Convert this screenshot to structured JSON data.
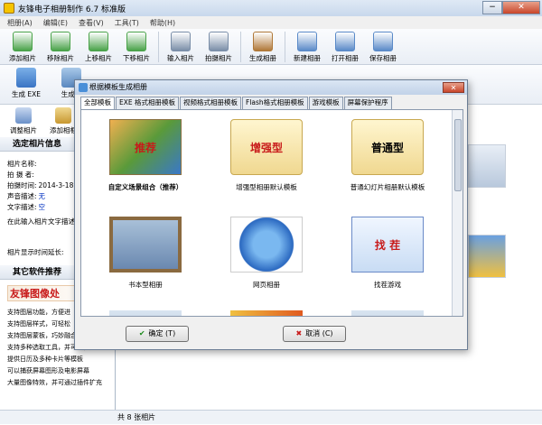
{
  "window": {
    "title": "友锋电子相册制作 6.7 标准版",
    "min": "−",
    "max": "□",
    "close": "✕"
  },
  "menu": [
    "相册(A)",
    "编辑(E)",
    "查看(V)",
    "工具(T)",
    "帮助(H)"
  ],
  "toolbar": [
    {
      "label": "添加相片",
      "icon": "add-photo-icon",
      "color": "#4aa34a"
    },
    {
      "label": "移除相片",
      "icon": "remove-photo-icon",
      "color": "#4aa34a"
    },
    {
      "label": "上移相片",
      "icon": "move-up-icon",
      "color": "#4aa34a"
    },
    {
      "label": "下移相片",
      "icon": "move-down-icon",
      "color": "#4aa34a"
    },
    {
      "label": "输入相片",
      "icon": "import-icon",
      "color": "#7a8ea8"
    },
    {
      "label": "拍摄相片",
      "icon": "camera-icon",
      "color": "#7a8ea8"
    },
    {
      "label": "生成相册",
      "icon": "generate-icon",
      "color": "#b07838"
    },
    {
      "label": "新建相册",
      "icon": "new-album-icon",
      "color": "#5a8ac8"
    },
    {
      "label": "打开相册",
      "icon": "open-album-icon",
      "color": "#5a8ac8"
    },
    {
      "label": "保存相册",
      "icon": "save-album-icon",
      "color": "#5a8ac8"
    }
  ],
  "toolbar2": [
    {
      "label": "生成 EXE",
      "icon": "exe-icon"
    },
    {
      "label": "生成相",
      "icon": "album-icon"
    }
  ],
  "toolbar3": [
    {
      "label": "调整相片",
      "icon": "adjust-icon"
    },
    {
      "label": "添加相框",
      "icon": "frame-icon"
    }
  ],
  "side": {
    "header": "选定相片信息",
    "name_label": "相片名称:",
    "author_label": "拍 摄 者:",
    "time_label": "拍摄时间:",
    "time_value": "2014-3-18",
    "sound_label": "声音描述:",
    "sound_value": "无",
    "text_label": "文字描述:",
    "text_value": "空",
    "hint": "在此输入相片文字描述",
    "delay": "相片显示时间延长:",
    "recommend_header": "其它软件推荐",
    "promo": "友锋图像处",
    "list": [
      "支持图层功能，方便进",
      "支持图层样式，可轻松",
      "支持图层蒙板，巧妙融合图像",
      "支持多种选取工具，并可羽化选区",
      "提供日历及多种卡片等模板",
      "可以捕获屏幕图形及电影屏幕",
      "大量图像特效，并可通过插件扩充"
    ]
  },
  "status": "共 8 张相片",
  "dialog": {
    "title": "根据模板生成相册",
    "close": "✕",
    "tabs": [
      "全部模板",
      "EXE 格式相册模板",
      "视频格式相册模板",
      "Flash格式相册模板",
      "游戏模板",
      "屏幕保护程序"
    ],
    "active_tab": 0,
    "items": [
      {
        "caption": "自定义场景组合（推荐）",
        "bold": true,
        "thumb": "scene",
        "text": "推荐"
      },
      {
        "caption": "增强型相册默认模板",
        "bold": false,
        "thumb": "folder",
        "text": "增强型"
      },
      {
        "caption": "普通幻灯片相册默认模板",
        "bold": false,
        "thumb": "folder",
        "text": "普通型"
      },
      {
        "caption": "书本型相册",
        "bold": false,
        "thumb": "book",
        "text": ""
      },
      {
        "caption": "网页相册",
        "bold": false,
        "thumb": "ie",
        "text": ""
      },
      {
        "caption": "找茬游戏",
        "bold": false,
        "thumb": "game",
        "text": "找 茬"
      }
    ],
    "ok": "确定 (T)",
    "cancel": "取消 (C)"
  }
}
